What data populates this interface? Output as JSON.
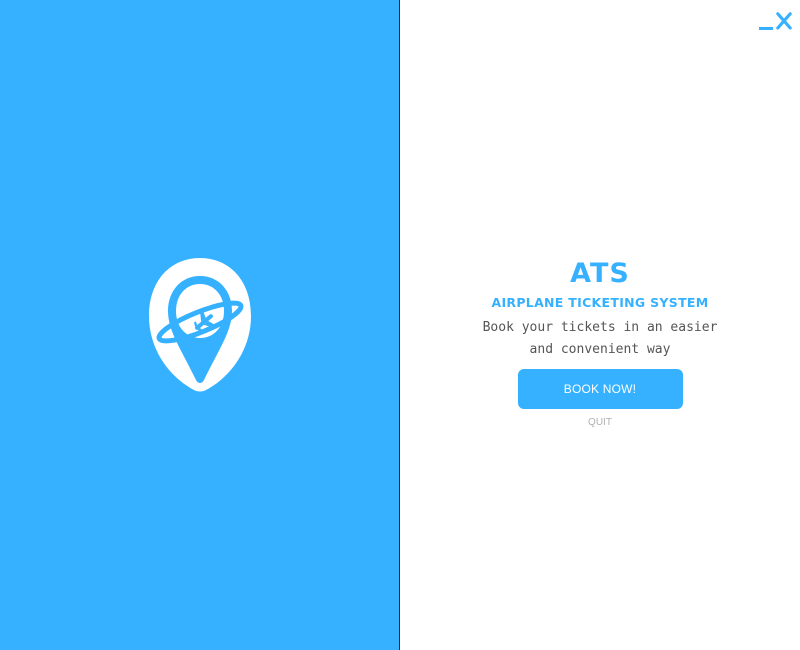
{
  "app": {
    "title": "ATS",
    "subtitle": "AIRPLANE TICKETING SYSTEM",
    "tagline": "Book your tickets in an easier and convenient way"
  },
  "actions": {
    "book_label": "BOOK NOW!",
    "quit_label": "QUIT"
  },
  "window_controls": {
    "minimize_icon": "minimize-icon",
    "close_icon": "close-icon"
  },
  "colors": {
    "accent": "#35b1ff",
    "logo_fill": "#ffffff",
    "tagline_text": "#555555",
    "quit_text": "#b0b0b0"
  },
  "icons": {
    "logo": "location-pin-airplane-logo"
  }
}
